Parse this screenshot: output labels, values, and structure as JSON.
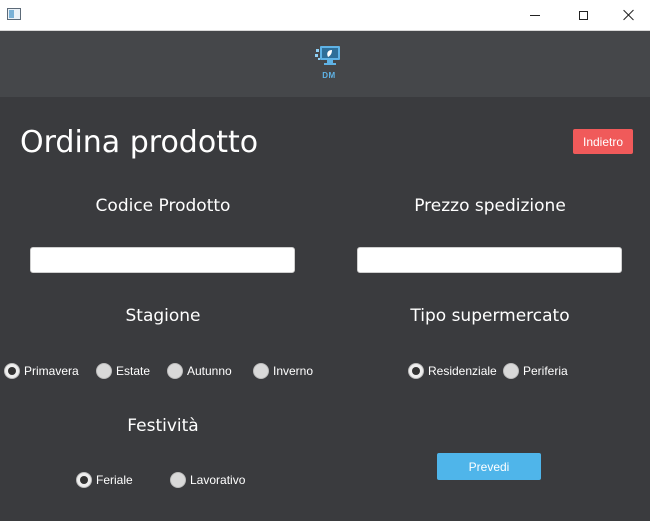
{
  "window": {
    "minimize_label": "—",
    "maximize_label": "☐",
    "close_label": "✕"
  },
  "header": {
    "logo_text": "DM",
    "logo_icon": "sprout-computer-logo",
    "accent_color": "#5fb3e6"
  },
  "page": {
    "title": "Ordina prodotto",
    "back_button": "Indietro"
  },
  "form": {
    "product_code": {
      "label": "Codice Prodotto",
      "value": "",
      "placeholder": ""
    },
    "shipping_price": {
      "label": "Prezzo spedizione",
      "value": "",
      "placeholder": ""
    },
    "season": {
      "label": "Stagione",
      "options": [
        "Primavera",
        "Estate",
        "Autunno",
        "Inverno"
      ],
      "selected": "Primavera"
    },
    "supermarket_type": {
      "label": "Tipo supermercato",
      "options": [
        "Residenziale",
        "Periferia"
      ],
      "selected": "Residenziale"
    },
    "holiday": {
      "label": "Festività",
      "options": [
        "Feriale",
        "Lavorativo"
      ],
      "selected": "Feriale"
    },
    "predict_button": "Prevedi"
  },
  "colors": {
    "background": "#3a3b3e",
    "header_band": "#45474a",
    "back_button": "#f05a5a",
    "predict_button": "#4fb5ea"
  }
}
